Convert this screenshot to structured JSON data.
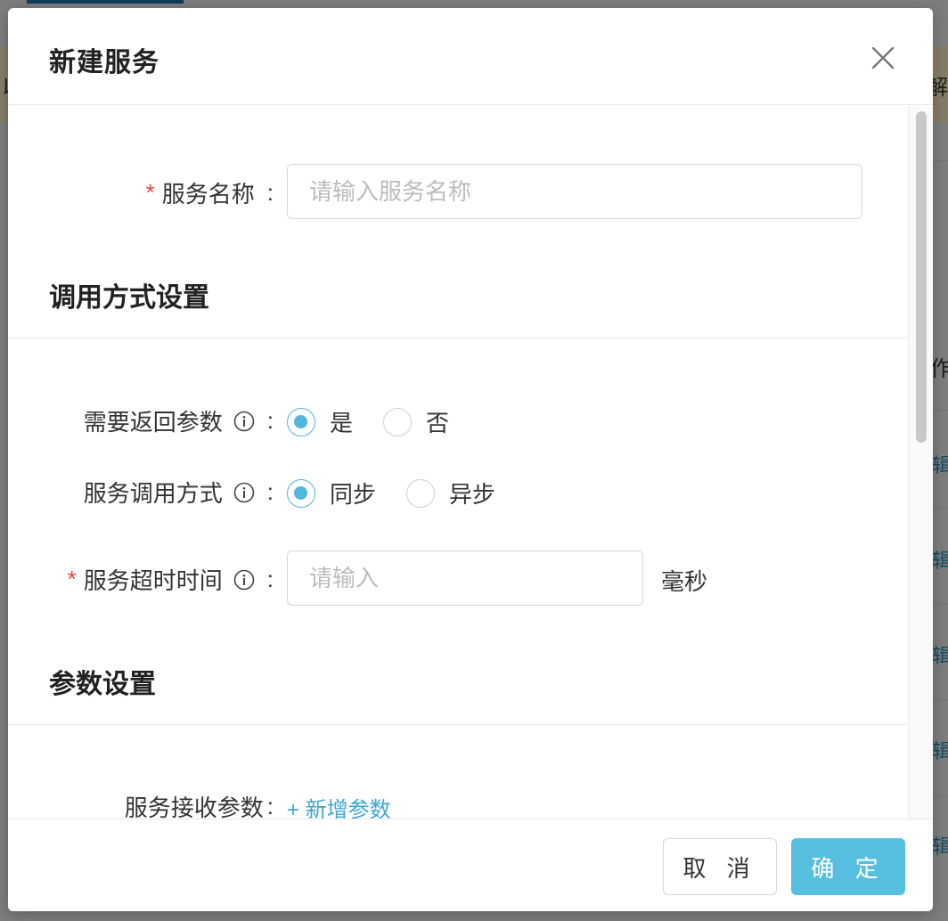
{
  "background": {
    "edge_fragments": [
      "以",
      "解",
      "作"
    ],
    "edge_links": [
      "辑",
      "辑",
      "辑",
      "辑",
      "辑"
    ]
  },
  "modal": {
    "title": "新建服务",
    "close_icon": "close-icon",
    "fields": {
      "service_name": {
        "label": "服务名称",
        "placeholder": "请输入服务名称",
        "value": ""
      },
      "call_section_title": "调用方式设置",
      "need_return": {
        "label": "需要返回参数",
        "options": [
          "是",
          "否"
        ],
        "selected": "是"
      },
      "call_mode": {
        "label": "服务调用方式",
        "options": [
          "同步",
          "异步"
        ],
        "selected": "同步"
      },
      "timeout": {
        "label": "服务超时时间",
        "placeholder": "请输入",
        "value": "",
        "unit": "毫秒"
      },
      "param_section_title": "参数设置",
      "receive_params": {
        "label": "服务接收参数",
        "add_label": "+ 新增参数"
      }
    },
    "colon": ":",
    "footer": {
      "cancel_label": "取 消",
      "ok_label": "确 定"
    }
  },
  "colors": {
    "accent": "#56bfe0",
    "required": "#e54545",
    "link": "#3ea5d0"
  }
}
